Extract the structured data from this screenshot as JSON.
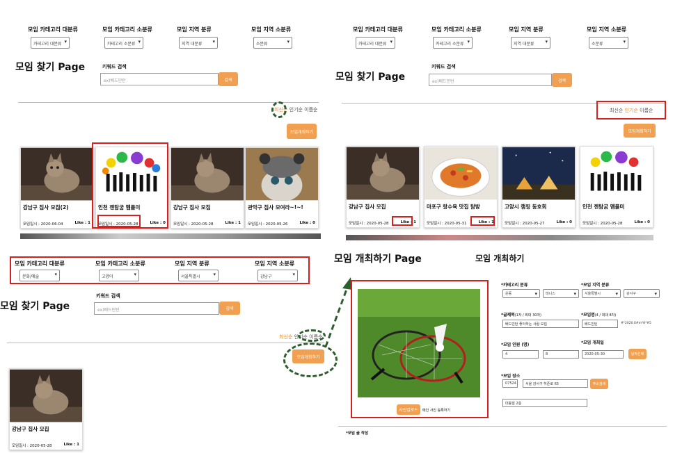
{
  "filters": {
    "cat_major": "모임 카테고리 대분류",
    "cat_minor": "모임 카테고리 소분류",
    "region_major": "모임 지역 분류",
    "region_minor": "모임 지역 소분류"
  },
  "p1": {
    "title": "모임 찾기 Page",
    "sel": [
      "카테고리 대분류",
      "카테고리 소분류",
      "지역 대분류",
      "소분류"
    ],
    "kw_label": "키워드 검색",
    "kw_ph": "ex)배드민턴",
    "search": "검색",
    "sort": [
      "최신순",
      "인기순",
      "이름순"
    ],
    "create": "모임개최하기",
    "cards": [
      {
        "title": "강남구 집사 모집(2)",
        "date": "모임일시 : 2020-06-04",
        "like": "Like : 1"
      },
      {
        "title": "인천 젠탐굼 멤플미",
        "date": "모임일시 : 2020-05-28",
        "like": "Like : 0"
      },
      {
        "title": "강남구 집사 모집",
        "date": "모임일시 : 2020-05-28",
        "like": "Like : 1"
      },
      {
        "title": "관악구 집사 모여라~!~!",
        "date": "모임일시 : 2020-05-26",
        "like": "Like : 0"
      }
    ]
  },
  "p2": {
    "title": "모임 찾기 Page",
    "sel": [
      "카테고리 대분류",
      "카테고리 소분류",
      "지역 대분류",
      "소분류"
    ],
    "kw_label": "키워드 검색",
    "kw_ph": "ex)배드민턴",
    "search": "검색",
    "sort": [
      "최신순",
      "인기순",
      "이름순"
    ],
    "create": "모임개최하기",
    "cards": [
      {
        "title": "강남구 집사 모집",
        "date": "모임일시 : 2020-05-28",
        "like": "Like : 1"
      },
      {
        "title": "마포구 랑수육 맛집 탐방",
        "date": "모임일시 : 2020-05-31",
        "like": "Like : 1"
      },
      {
        "title": "고양시 캠핑 동호회",
        "date": "모임일시 : 2020-05-27",
        "like": "Like : 0"
      },
      {
        "title": "인천 젠탐굼 멤플미",
        "date": "모임일시 : 2020-05-28",
        "like": "Like : 0"
      }
    ]
  },
  "p3": {
    "title": "모임 찾기 Page",
    "sel": [
      "문화/예술",
      "고양이",
      "서울특별시",
      "강남구"
    ],
    "kw_label": "키워드 검색",
    "kw_ph": "ex)배드민턴",
    "search": "검색",
    "sort": [
      "최신순",
      "인기순",
      "이름순"
    ],
    "create": "모임개최하기",
    "cards": [
      {
        "title": "강남구 집사 모집",
        "date": "모임일시 : 2020-05-28",
        "like": "Like : 1"
      }
    ]
  },
  "p4": {
    "title": "모임 개최하기 Page",
    "form_title": "모임 개최하기",
    "upload": "사진업로드",
    "upload_note": "메인 사진 등록하기",
    "l_cat": "*카테고리 분류",
    "cat1": "운동",
    "cat2": "테니스",
    "l_region": "*모임 지역 분류",
    "reg1": "서울특별시",
    "reg2": "강서구",
    "l_subject": "*글제목",
    "subject_hint": "(1자 / 최대 30자)",
    "subject": "배드민턴 좋아하는 사람 모집",
    "l_name": "*모임명",
    "name_hint": "(4 / 최대 8자)",
    "name": "배드민턴",
    "name_note": "#*2020.0#m*8*#5",
    "l_people": "*모임 인원 (명)",
    "people_min": "4",
    "people_max": "8",
    "l_date": "*모임 개최일",
    "date": "2020-05-30",
    "date_btn": "날짜선택",
    "l_place": "*모임 장소",
    "zip": "07524",
    "addr": "서울 강서구 허준로 65",
    "addr_btn": "주소검색",
    "addr2": "대동빌 2층",
    "l_write": "*모임 글 작성"
  }
}
